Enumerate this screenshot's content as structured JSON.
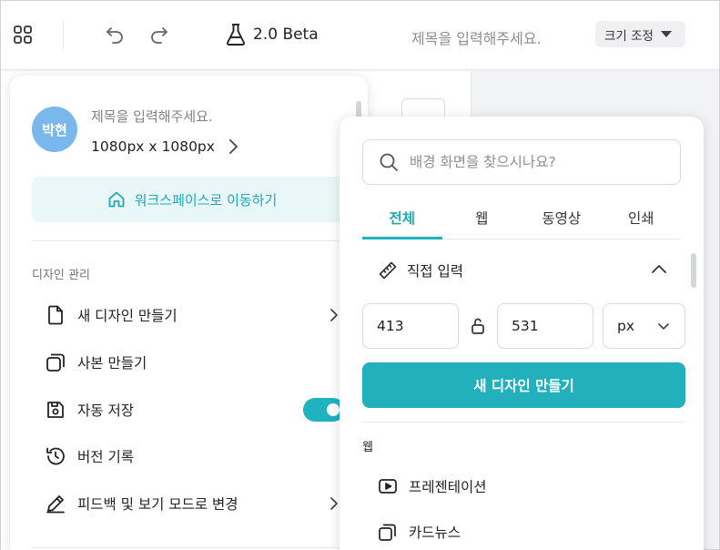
{
  "topbar": {
    "version": "2.0 Beta",
    "title_placeholder": "제목을 입력해주세요.",
    "resize_label": "크기 조정"
  },
  "menu": {
    "avatar_text": "박현",
    "project_title": "제목을 입력해주세요.",
    "project_size": "1080px x 1080px",
    "workspace_button": "워크스페이스로 이동하기",
    "section_label": "디자인 관리",
    "items": [
      {
        "label": "새 디자인 만들기",
        "icon": "file-icon",
        "has_chevron": true
      },
      {
        "label": "사본 만들기",
        "icon": "copy-icon"
      },
      {
        "label": "자동 저장",
        "icon": "save-icon",
        "toggle_on": true
      },
      {
        "label": "버전 기록",
        "icon": "history-icon"
      },
      {
        "label": "피드백 및 보기 모드로 변경",
        "icon": "pencil-icon",
        "has_chevron": true
      }
    ]
  },
  "size_panel": {
    "search_placeholder": "배경 화면을 찾으시나요?",
    "tabs": [
      {
        "label": "전체",
        "active": true
      },
      {
        "label": "웹"
      },
      {
        "label": "동영상"
      },
      {
        "label": "인쇄"
      }
    ],
    "direct_input_label": "직접 입력",
    "width": "413",
    "height": "531",
    "unit": "px",
    "create_button": "새 디자인 만들기",
    "section_web": "웹",
    "categories": [
      {
        "label": "프레젠테이션",
        "icon": "play-icon"
      },
      {
        "label": "카드뉴스",
        "icon": "cards-icon"
      }
    ]
  },
  "colors": {
    "accent": "#22b0bd",
    "avatar": "#79b7ec",
    "workspace_bg": "#e9f7f8"
  }
}
